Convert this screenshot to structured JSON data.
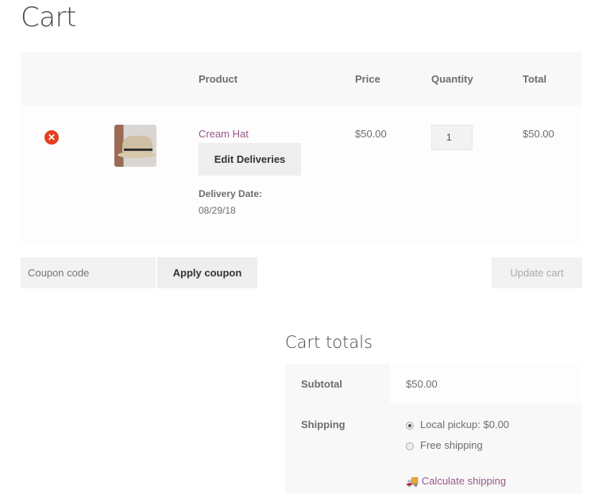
{
  "page": {
    "title": "Cart"
  },
  "table": {
    "headers": [
      "Product",
      "Price",
      "Quantity",
      "Total"
    ]
  },
  "item": {
    "name": "Cream Hat",
    "price": "$50.00",
    "quantity": "1",
    "total": "$50.00",
    "edit_label": "Edit Deliveries",
    "delivery_label": "Delivery Date:",
    "delivery_date": "08/29/18",
    "remove_icon": "remove-circle-x"
  },
  "actions": {
    "coupon_placeholder": "Coupon code",
    "apply_label": "Apply coupon",
    "update_label": "Update cart"
  },
  "totals": {
    "title": "Cart totals",
    "subtotal_label": "Subtotal",
    "subtotal": "$50.00",
    "shipping_label": "Shipping",
    "options": [
      "Local pickup: $0.00",
      "Free shipping"
    ],
    "selected": 0,
    "calc_label": "Calculate shipping"
  },
  "colors": {
    "link": "#96588a",
    "remove": "#e2401c"
  }
}
